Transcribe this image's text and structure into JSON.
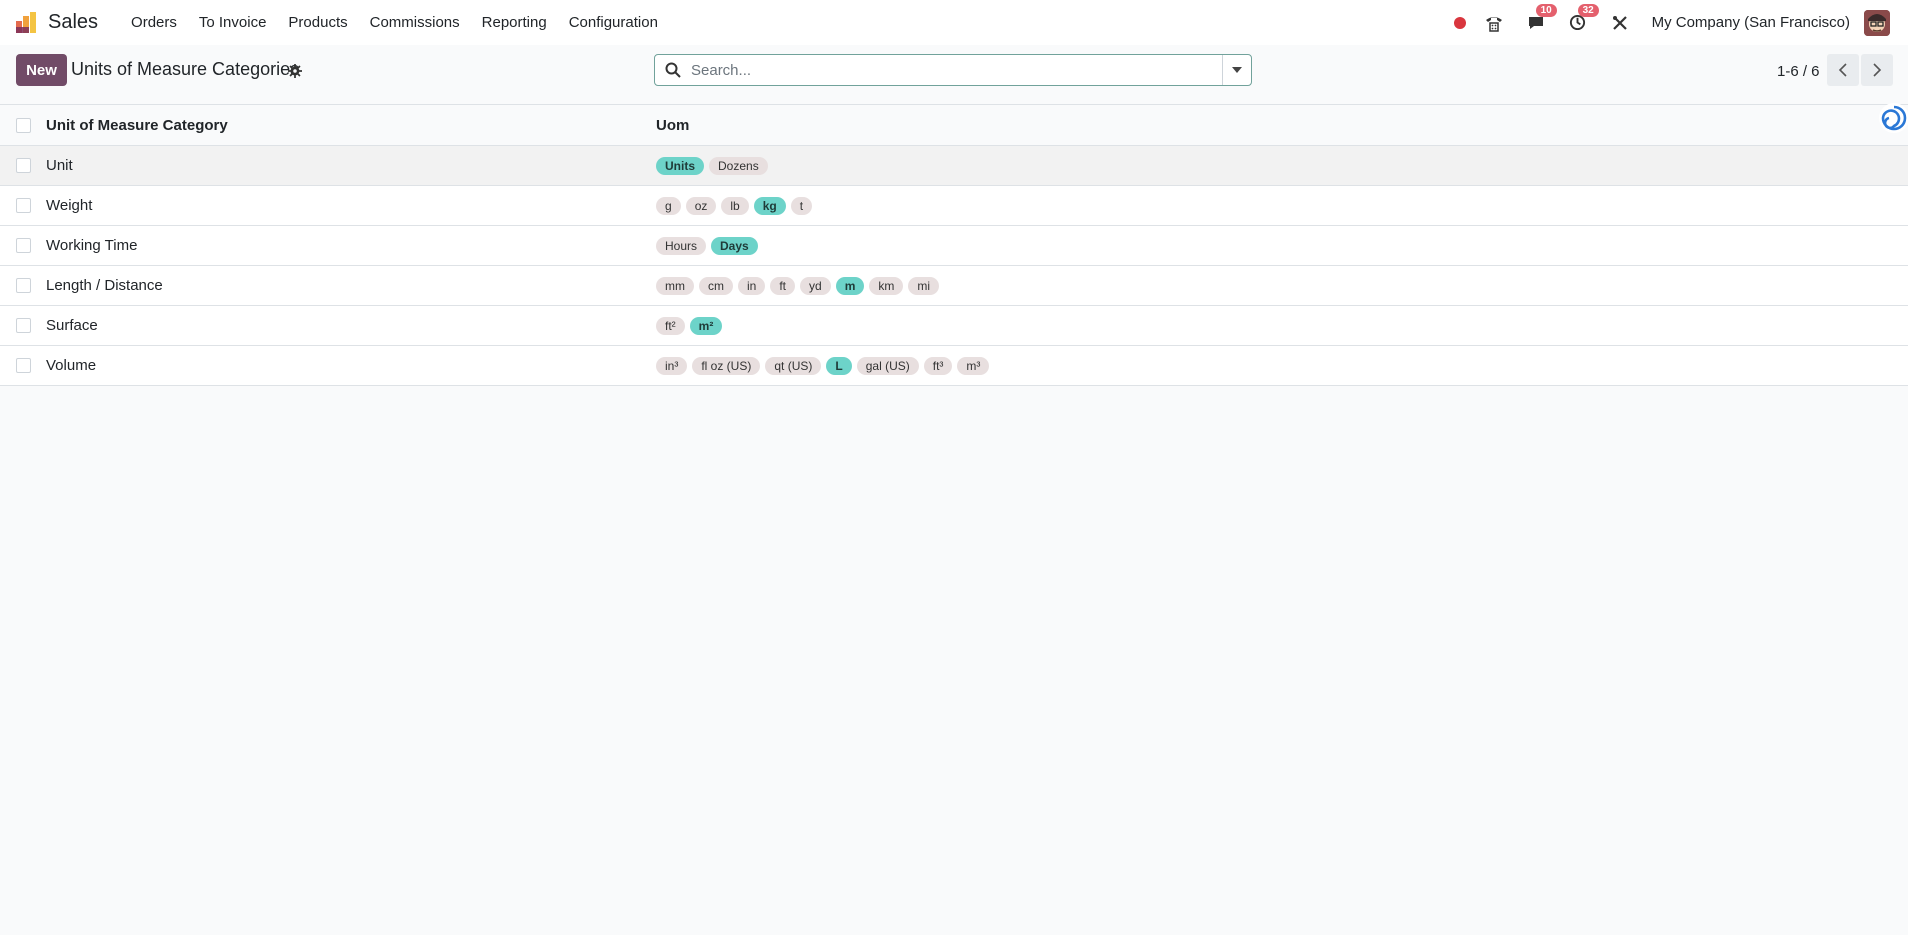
{
  "navbar": {
    "app_name": "Sales",
    "menu": [
      "Orders",
      "To Invoice",
      "Products",
      "Commissions",
      "Reporting",
      "Configuration"
    ],
    "messages_count": "10",
    "activities_count": "32",
    "company": "My Company (San Francisco)"
  },
  "control": {
    "new_label": "New",
    "title": "Units of Measure Categories",
    "search_placeholder": "Search...",
    "pager": "1-6 / 6"
  },
  "list": {
    "headers": {
      "name": "Unit of Measure Category",
      "uom": "Uom"
    },
    "rows": [
      {
        "name": "Unit",
        "uoms": [
          {
            "label": "Units",
            "ref": true
          },
          {
            "label": "Dozens",
            "ref": false
          }
        ]
      },
      {
        "name": "Weight",
        "uoms": [
          {
            "label": "g",
            "ref": false
          },
          {
            "label": "oz",
            "ref": false
          },
          {
            "label": "lb",
            "ref": false
          },
          {
            "label": "kg",
            "ref": true
          },
          {
            "label": "t",
            "ref": false
          }
        ]
      },
      {
        "name": "Working Time",
        "uoms": [
          {
            "label": "Hours",
            "ref": false
          },
          {
            "label": "Days",
            "ref": true
          }
        ]
      },
      {
        "name": "Length / Distance",
        "uoms": [
          {
            "label": "mm",
            "ref": false
          },
          {
            "label": "cm",
            "ref": false
          },
          {
            "label": "in",
            "ref": false
          },
          {
            "label": "ft",
            "ref": false
          },
          {
            "label": "yd",
            "ref": false
          },
          {
            "label": "m",
            "ref": true
          },
          {
            "label": "km",
            "ref": false
          },
          {
            "label": "mi",
            "ref": false
          }
        ]
      },
      {
        "name": "Surface",
        "uoms": [
          {
            "label": "ft²",
            "ref": false
          },
          {
            "label": "m²",
            "ref": true
          }
        ]
      },
      {
        "name": "Volume",
        "uoms": [
          {
            "label": "in³",
            "ref": false
          },
          {
            "label": "fl oz (US)",
            "ref": false
          },
          {
            "label": "qt (US)",
            "ref": false
          },
          {
            "label": "L",
            "ref": true
          },
          {
            "label": "gal (US)",
            "ref": false
          },
          {
            "label": "ft³",
            "ref": false
          },
          {
            "label": "m³",
            "ref": false
          }
        ]
      }
    ]
  },
  "colors": {
    "brand": "#714b67",
    "reference_tag": "#6dd3c9",
    "tag": "#e8dfdf"
  }
}
